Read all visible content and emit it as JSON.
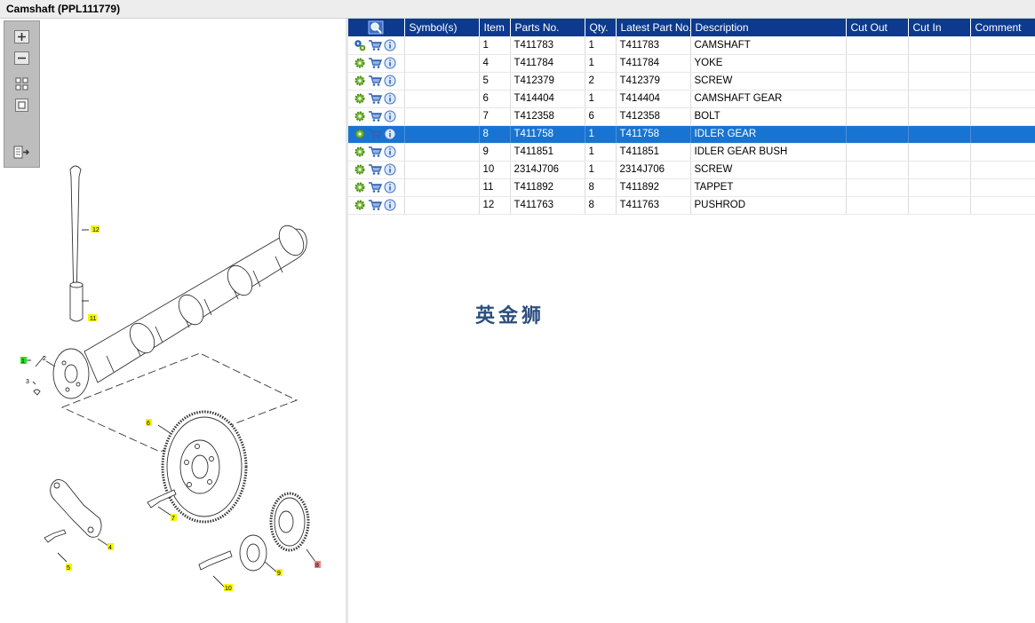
{
  "window": {
    "title": "Camshaft (PPL111779)"
  },
  "table": {
    "columns": [
      "",
      "Symbol(s)",
      "Item",
      "Parts No.",
      "Qty.",
      "Latest Part No.",
      "Description",
      "Cut Out",
      "Cut In",
      "Comment"
    ],
    "rows": [
      {
        "item": "1",
        "parts_no": "T411783",
        "qty": "1",
        "latest": "T411783",
        "description": "CAMSHAFT",
        "selected": false
      },
      {
        "item": "4",
        "parts_no": "T411784",
        "qty": "1",
        "latest": "T411784",
        "description": "YOKE",
        "selected": false
      },
      {
        "item": "5",
        "parts_no": "T412379",
        "qty": "2",
        "latest": "T412379",
        "description": "SCREW",
        "selected": false
      },
      {
        "item": "6",
        "parts_no": "T414404",
        "qty": "1",
        "latest": "T414404",
        "description": "CAMSHAFT GEAR",
        "selected": false
      },
      {
        "item": "7",
        "parts_no": "T412358",
        "qty": "6",
        "latest": "T412358",
        "description": "BOLT",
        "selected": false
      },
      {
        "item": "8",
        "parts_no": "T411758",
        "qty": "1",
        "latest": "T411758",
        "description": "IDLER GEAR",
        "selected": true
      },
      {
        "item": "9",
        "parts_no": "T411851",
        "qty": "1",
        "latest": "T411851",
        "description": "IDLER GEAR BUSH",
        "selected": false
      },
      {
        "item": "10",
        "parts_no": "2314J706",
        "qty": "1",
        "latest": "2314J706",
        "description": "SCREW",
        "selected": false
      },
      {
        "item": "11",
        "parts_no": "T411892",
        "qty": "8",
        "latest": "T411892",
        "description": "TAPPET",
        "selected": false
      },
      {
        "item": "12",
        "parts_no": "T411763",
        "qty": "8",
        "latest": "T411763",
        "description": "PUSHROD",
        "selected": false
      }
    ]
  },
  "diagram": {
    "callouts": [
      "12",
      "11",
      "1",
      "2",
      "3",
      "6",
      "7",
      "4",
      "5",
      "8",
      "9",
      "10"
    ]
  },
  "watermark": "英金狮",
  "colors": {
    "header": "#0d3a8e",
    "selected": "#1874d2",
    "callout_yellow": "#f5f500",
    "callout_green": "#22e622",
    "callout_red": "#f08080"
  },
  "icons": {
    "row_actions": [
      "gear-icon",
      "cart-icon",
      "info-icon"
    ],
    "header_search": "magnifier-icon"
  }
}
